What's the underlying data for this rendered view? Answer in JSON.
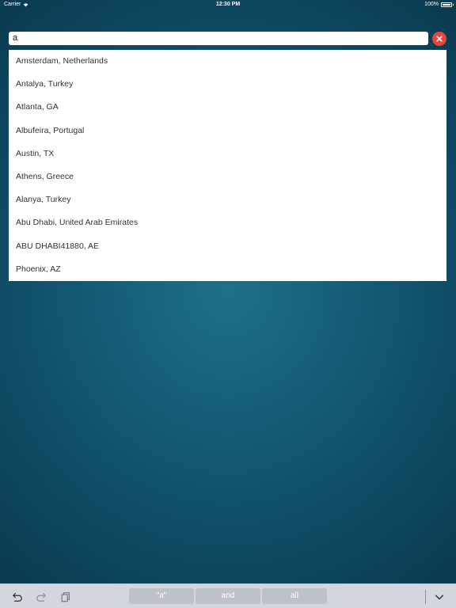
{
  "status_bar": {
    "carrier": "Carrier",
    "time": "12:30 PM",
    "battery": "100%",
    "battery_level": 1.0
  },
  "search": {
    "value": "a",
    "clear_icon": "close-icon",
    "clear_color": "#e8453c"
  },
  "suggestions": [
    "Amsterdam, Netherlands",
    "Antalya, Turkey",
    "Atlanta, GA",
    "Albufeira, Portugal",
    "Austin, TX",
    "Athens, Greece",
    "Alanya, Turkey",
    "Abu Dhabi, United Arab Emirates",
    "ABU DHABI41880, AE",
    "Phoenix, AZ"
  ],
  "keyboard_toolbar": {
    "undo_icon": "undo-icon",
    "redo_icon": "redo-icon",
    "paste_icon": "paste-icon",
    "predictions": [
      "\"a\"",
      "and",
      "all"
    ],
    "dismiss_icon": "chevron-down-icon"
  }
}
